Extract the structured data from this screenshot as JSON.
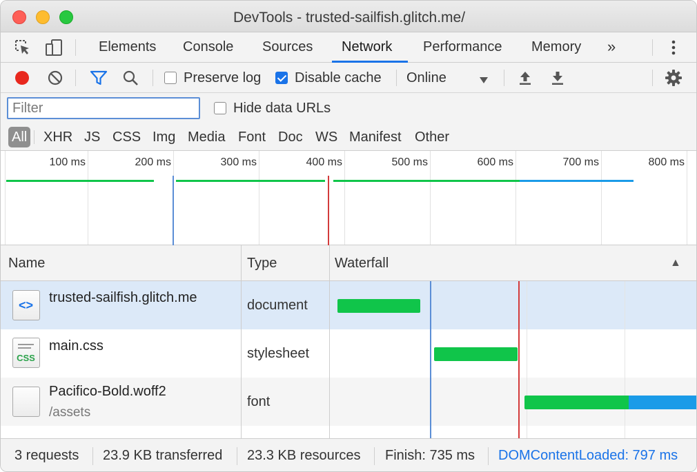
{
  "window": {
    "title": "DevTools - trusted-sailfish.glitch.me/"
  },
  "tabs": [
    {
      "label": "Elements"
    },
    {
      "label": "Console"
    },
    {
      "label": "Sources"
    },
    {
      "label": "Network",
      "active": true
    },
    {
      "label": "Performance"
    },
    {
      "label": "Memory"
    }
  ],
  "tabs_overflow_label": "»",
  "toolbar": {
    "preserve_log_label": "Preserve log",
    "preserve_log_checked": false,
    "disable_cache_label": "Disable cache",
    "disable_cache_checked": true,
    "throttling_value": "Online"
  },
  "filter": {
    "placeholder": "Filter",
    "hide_data_urls_label": "Hide data URLs"
  },
  "type_filters": [
    "All",
    "XHR",
    "JS",
    "CSS",
    "Img",
    "Media",
    "Font",
    "Doc",
    "WS",
    "Manifest",
    "Other"
  ],
  "overview": {
    "ticks": [
      "100 ms",
      "200 ms",
      "300 ms",
      "400 ms",
      "500 ms",
      "600 ms",
      "700 ms",
      "800 ms"
    ]
  },
  "table": {
    "columns": {
      "name": "Name",
      "type": "Type",
      "waterfall": "Waterfall"
    },
    "sort_indicator": "▲",
    "rows": [
      {
        "name": "trusted-sailfish.glitch.me",
        "path": "",
        "type": "document",
        "icon": "html-document-icon"
      },
      {
        "name": "main.css",
        "path": "",
        "type": "stylesheet",
        "icon": "css-file-icon"
      },
      {
        "name": "Pacifico-Bold.woff2",
        "path": "/assets",
        "type": "font",
        "icon": "font-file-icon"
      }
    ]
  },
  "status": {
    "requests": "3 requests",
    "transferred": "23.9 KB transferred",
    "resources": "23.3 KB resources",
    "finish": "Finish: 735 ms",
    "dom_content_loaded": "DOMContentLoaded: 797 ms"
  },
  "colors": {
    "accent": "#1a73e8",
    "record_red": "#e8281e",
    "waiting_green": "#10c54a",
    "download_blue": "#1a9be8",
    "dom_line_blue": "#5b8ed6",
    "load_line_red": "#d33b3b",
    "selected_row": "#dce9f8",
    "stripe_row": "#f5f5f5"
  }
}
